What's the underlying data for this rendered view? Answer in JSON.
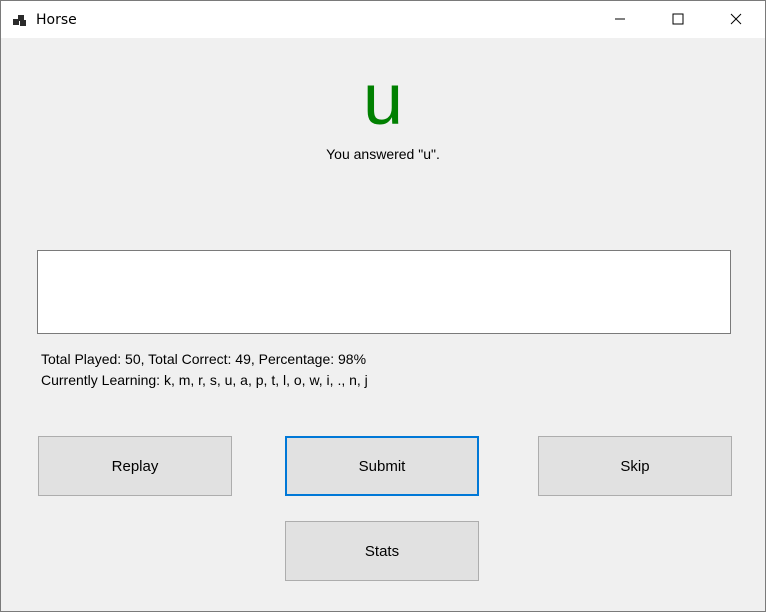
{
  "window": {
    "title": "Horse",
    "icon": "app-window-icon",
    "controls": [
      "minimize-icon",
      "maximize-icon",
      "close-icon"
    ]
  },
  "prompt": {
    "letter": "u",
    "letter_color": "#008000",
    "feedback": "You answered \"u\"."
  },
  "answer_input": {
    "value": ""
  },
  "stats": {
    "summary": "Total Played: 50, Total Correct: 49, Percentage: 98%",
    "learning": "Currently Learning: k, m, r, s, u, a, p, t, l, o, w, i, ., n, j"
  },
  "buttons": {
    "replay": "Replay",
    "submit": "Submit",
    "skip": "Skip",
    "stats": "Stats"
  },
  "colors": {
    "focus_border": "#0078d7",
    "button_face": "#e1e1e1",
    "window_background": "#f0f0f0"
  }
}
